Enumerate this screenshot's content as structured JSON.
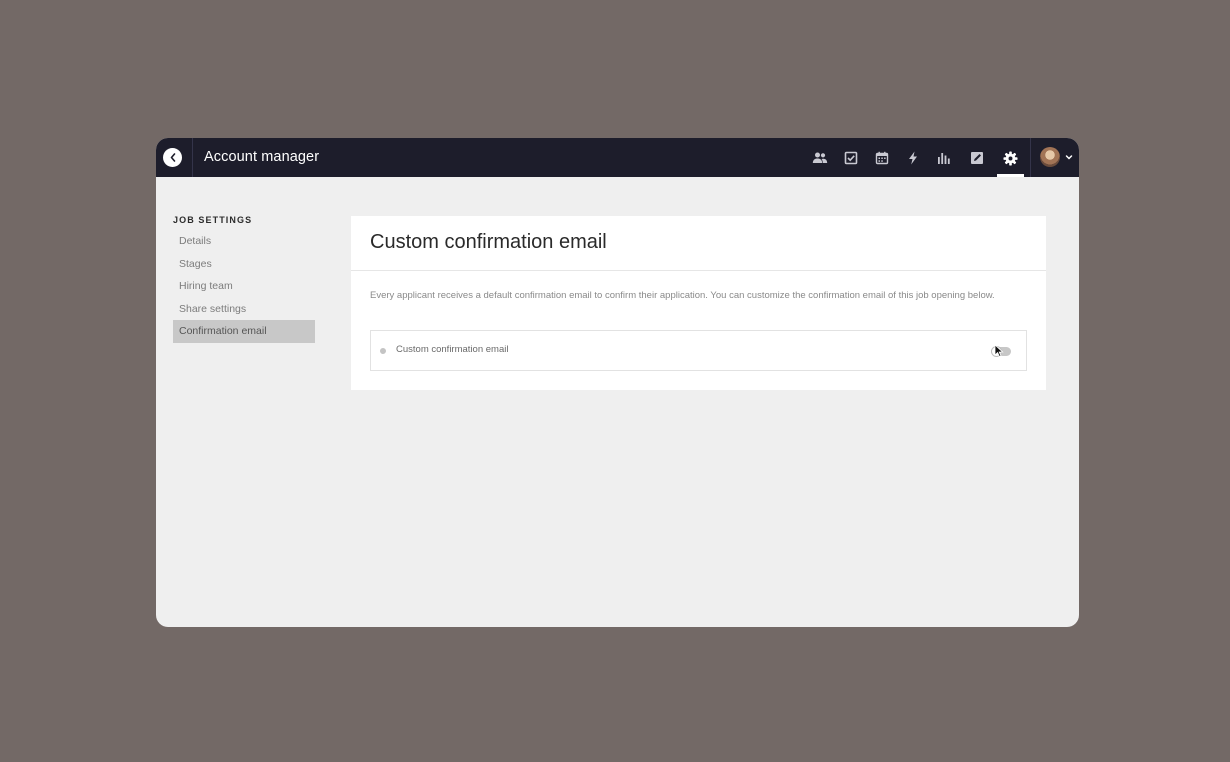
{
  "header": {
    "title": "Account manager",
    "nav_icons": [
      "people-icon",
      "tasks-icon",
      "calendar-icon",
      "bolt-icon",
      "reports-icon",
      "edit-icon",
      "settings-icon"
    ],
    "active_nav": "settings-icon"
  },
  "sidebar": {
    "heading": "JOB SETTINGS",
    "items": [
      {
        "label": "Details"
      },
      {
        "label": "Stages"
      },
      {
        "label": "Hiring team"
      },
      {
        "label": "Share settings"
      },
      {
        "label": "Confirmation email",
        "active": true
      }
    ]
  },
  "main": {
    "title": "Custom confirmation email",
    "description": "Every applicant receives a default confirmation email to confirm their application. You can customize the confirmation email of this job opening below.",
    "option": {
      "label": "Custom confirmation email",
      "toggle_on": false
    }
  },
  "colors": {
    "topbar": "#1d1d2b",
    "page_bg": "#736966",
    "window_bg": "#efefef",
    "active_item_bg": "#c8c8c8"
  }
}
